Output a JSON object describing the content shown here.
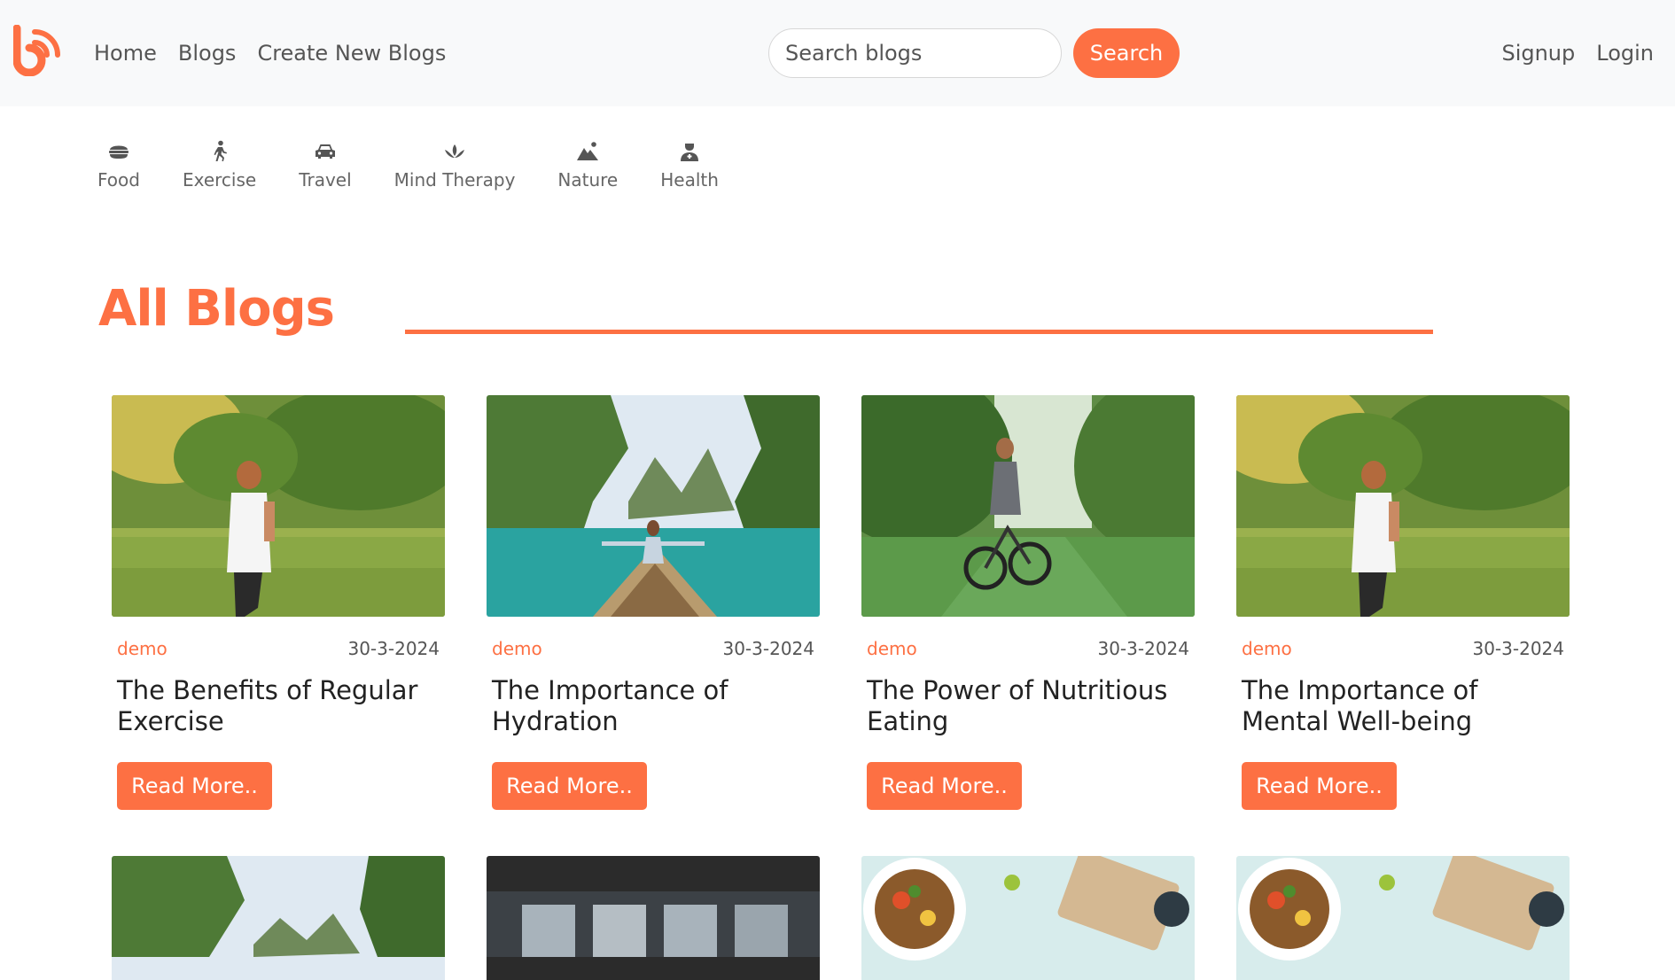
{
  "nav": {
    "home": "Home",
    "blogs": "Blogs",
    "create": "Create New Blogs",
    "search_placeholder": "Search blogs",
    "search_button": "Search",
    "signup": "Signup",
    "login": "Login"
  },
  "categories": [
    {
      "label": "Food",
      "icon": "food-icon"
    },
    {
      "label": "Exercise",
      "icon": "exercise-icon"
    },
    {
      "label": "Travel",
      "icon": "travel-icon"
    },
    {
      "label": "Mind Therapy",
      "icon": "mind-therapy-icon"
    },
    {
      "label": "Nature",
      "icon": "nature-icon"
    },
    {
      "label": "Health",
      "icon": "health-icon"
    }
  ],
  "section": {
    "title": "All Blogs"
  },
  "colors": {
    "accent": "#fd7043",
    "navbar_bg": "#f8f9fa"
  },
  "cards": [
    {
      "author": "demo",
      "date": "30-3-2024",
      "title": "The Benefits of Regular Exercise",
      "button": "Read More..",
      "image": "woman-running-park-photo"
    },
    {
      "author": "demo",
      "date": "30-3-2024",
      "title": "The Importance of Hydration",
      "button": "Read More..",
      "image": "woman-on-boat-photo"
    },
    {
      "author": "demo",
      "date": "30-3-2024",
      "title": "The Power of Nutritious Eating",
      "button": "Read More..",
      "image": "man-cycling-photo"
    },
    {
      "author": "demo",
      "date": "30-3-2024",
      "title": "The Importance of Mental Well-being",
      "button": "Read More..",
      "image": "woman-running-park-photo"
    }
  ],
  "next_row_images": [
    "tropical-cliffs-photo",
    "dark-gym-photo",
    "salad-bowl-photo",
    "salad-bowl-photo"
  ]
}
